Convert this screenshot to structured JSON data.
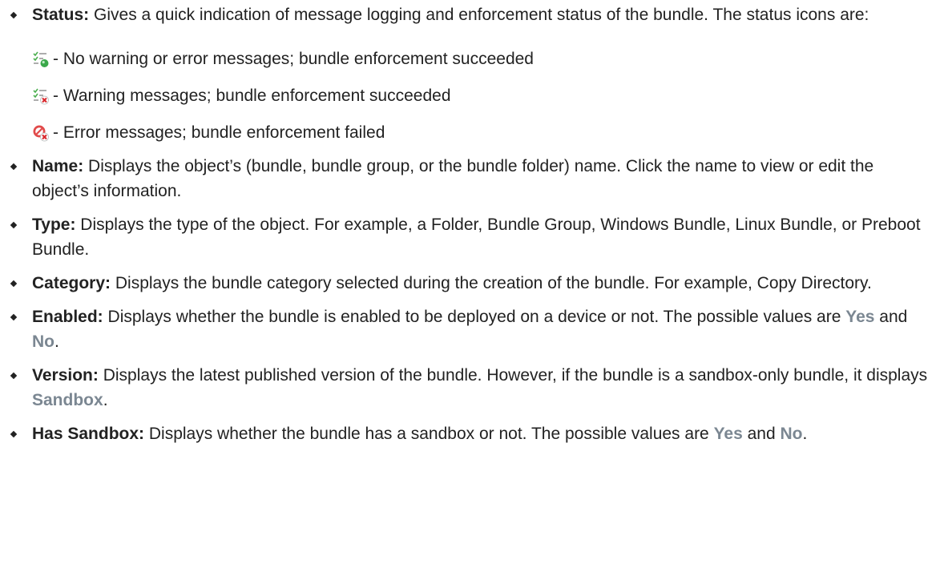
{
  "items": [
    {
      "term": "Status:",
      "text": " Gives a quick indication of message logging and enforcement status of the bundle. The status icons are:"
    },
    {
      "term": "Name:",
      "text": " Displays the object’s (bundle, bundle group, or the bundle folder) name. Click the name to view or edit the object’s information."
    },
    {
      "term": "Type:",
      "text": " Displays the type of the object. For example, a Folder, Bundle Group, Windows Bundle, Linux Bundle, or Preboot Bundle."
    },
    {
      "term": "Category:",
      "text": " Displays the bundle category selected during the creation of the bundle. For example, Copy Directory."
    },
    {
      "term": "Enabled:",
      "text_a": " Displays whether the bundle is enabled to be deployed on a device or not. The possible values are ",
      "kw1": "Yes",
      "text_b": " and ",
      "kw2": "No",
      "text_c": "."
    },
    {
      "term": "Version:",
      "text_a": " Displays the latest published version of the bundle. However, if the bundle is a sandbox-only bundle, it displays ",
      "kw1": "Sandbox",
      "text_b": "."
    },
    {
      "term": "Has Sandbox:",
      "text_a": " Displays whether the bundle has a sandbox or not. The possible values are ",
      "kw1": "Yes",
      "text_b": " and ",
      "kw2": "No",
      "text_c": "."
    }
  ],
  "status_icons": [
    {
      "icon": "status-ok-icon",
      "text": " - No warning or error messages; bundle enforcement succeeded"
    },
    {
      "icon": "status-warning-icon",
      "text": " - Warning messages; bundle enforcement succeeded"
    },
    {
      "icon": "status-error-icon",
      "text": " - Error messages; bundle enforcement failed"
    }
  ],
  "colors": {
    "keyword": "#7b8792",
    "ok": "#3aa84a",
    "error": "#d9262b"
  }
}
